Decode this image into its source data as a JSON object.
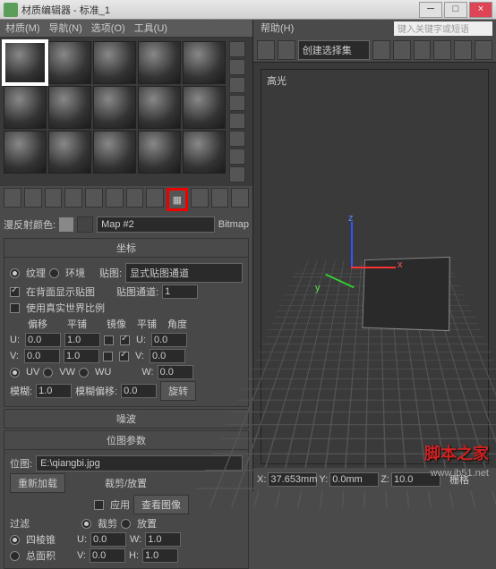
{
  "window": {
    "title": "材质编辑器 - 标准_1"
  },
  "menu": {
    "m1": "材质(M)",
    "m2": "导航(N)",
    "m3": "选项(O)",
    "m4": "工具(U)"
  },
  "maprow": {
    "label": "漫反射颜色:",
    "mapname": "Map #2",
    "type": "Bitmap"
  },
  "coords": {
    "title": "坐标",
    "r_texture": "纹理",
    "r_env": "环境",
    "maplbl": "贴图:",
    "mapchannel": "显式贴图通道",
    "showback": "在背面显示贴图",
    "realworld": "使用真实世界比例",
    "chanlbl": "贴图通道:",
    "chanval": "1",
    "h_offset": "偏移",
    "h_tile": "平铺",
    "h_mirror": "镜像",
    "h_tlie2": "平铺",
    "h_angle": "角度",
    "u": "U:",
    "v": "V:",
    "w": "W:",
    "u_off": "0.0",
    "u_tile": "1.0",
    "u_ang": "0.0",
    "v_off": "0.0",
    "v_tile": "1.0",
    "v_ang": "0.0",
    "w_ang": "0.0",
    "uv": "UV",
    "vw": "VW",
    "wu": "WU",
    "blur": "模糊:",
    "blur_v": "1.0",
    "bluroff": "模糊偏移:",
    "bluroff_v": "0.0",
    "rotate": "旋转"
  },
  "noise": {
    "title": "噪波"
  },
  "bitmap": {
    "title": "位图参数",
    "bitlbl": "位图:",
    "path": "E:\\qiangbi.jpg",
    "reload": "重新加载",
    "croplbl": "裁剪/放置",
    "apply": "应用",
    "view": "查看图像",
    "crop": "裁剪",
    "place": "放置",
    "filterlbl": "过滤",
    "pyramid": "四棱锥",
    "area": "总面积",
    "ul": "U:",
    "vl": "V:",
    "wl": "W:",
    "hl": "H:",
    "u": "0.0",
    "v": "0.0",
    "w": "1.0",
    "h": "1.0"
  },
  "right": {
    "help": "帮助(H)",
    "search": "键入关键字或短语",
    "createsel": "创建选择集",
    "highlight": "高光",
    "coords": {
      "x": "X:",
      "y": "Y:",
      "z": "Z:",
      "xv": "37.653mm",
      "yv": "0.0mm",
      "zv": "10.0"
    },
    "grid": "栅格"
  },
  "watermark": {
    "text": "脚本之家",
    "url": "www.jb51.net"
  }
}
